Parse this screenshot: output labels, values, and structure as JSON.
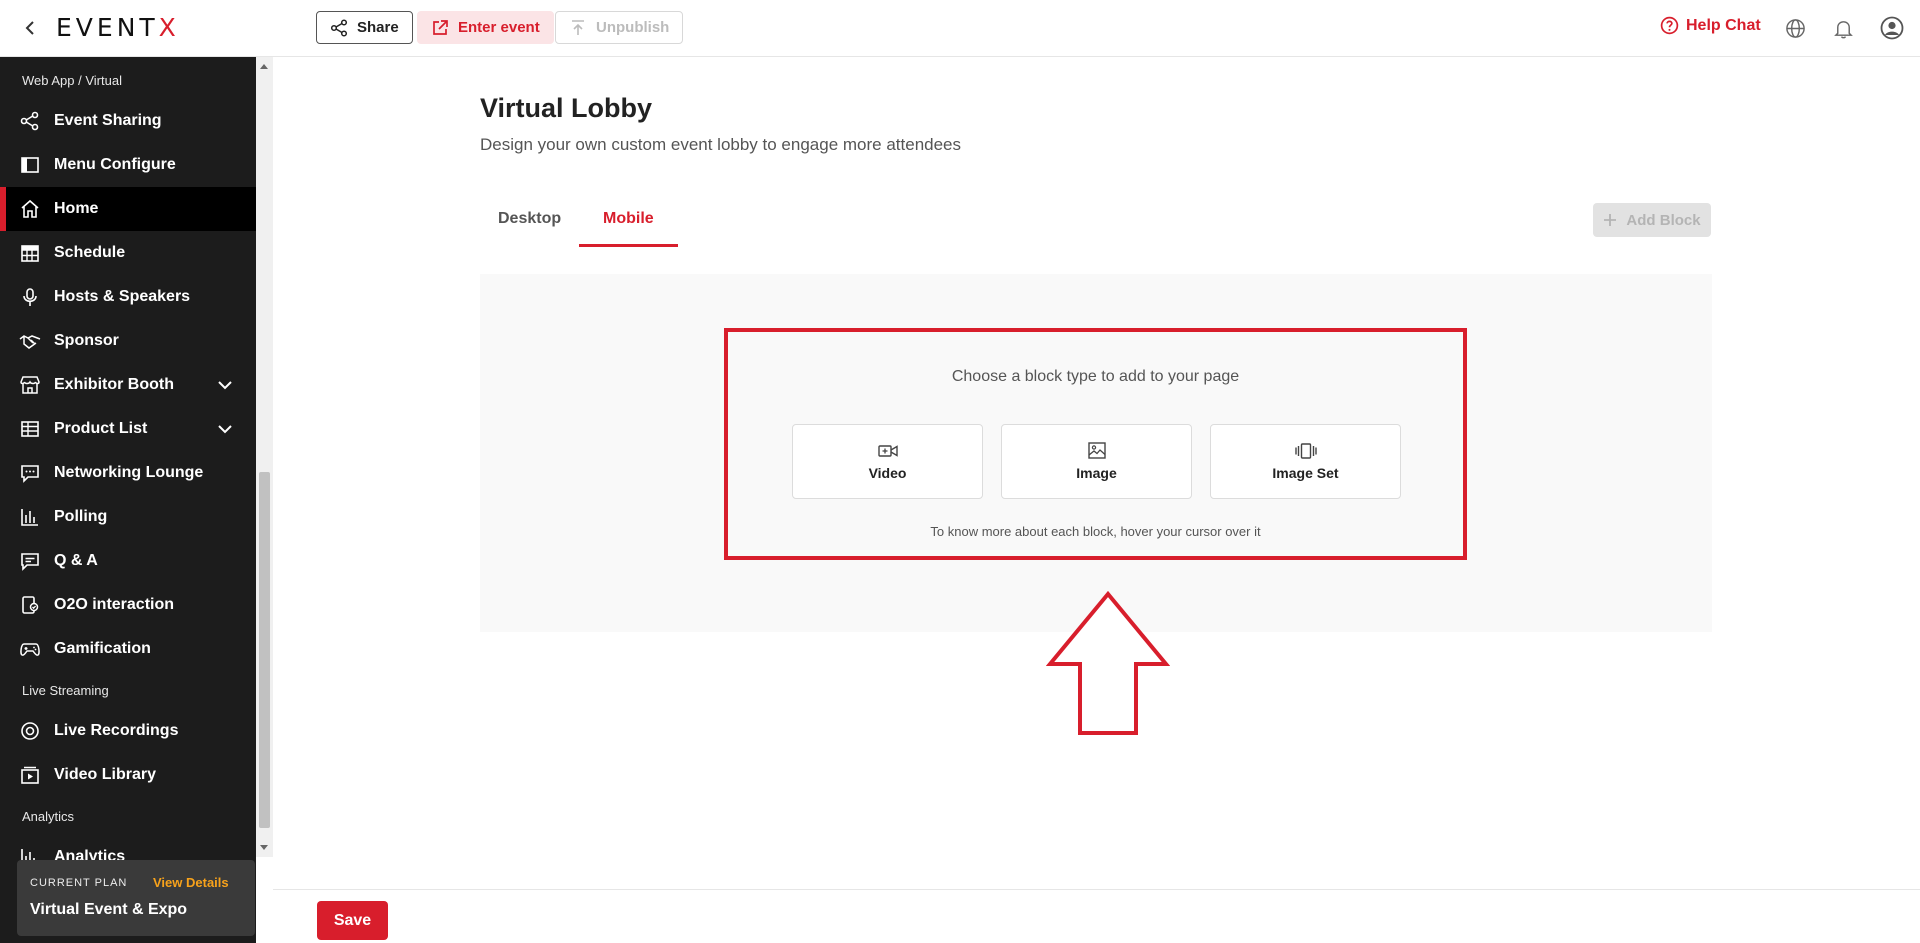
{
  "header": {
    "logo_main": "EVENT",
    "logo_accent": "X",
    "share_label": "Share",
    "enter_event_label": "Enter event",
    "unpublish_label": "Unpublish",
    "help_chat_label": "Help Chat"
  },
  "sidebar": {
    "section_web_app": "Web App / Virtual",
    "section_live_streaming": "Live Streaming",
    "section_analytics": "Analytics",
    "items": [
      {
        "label": "Event Sharing",
        "icon": "share-icon"
      },
      {
        "label": "Menu Configure",
        "icon": "panel-icon"
      },
      {
        "label": "Home",
        "icon": "home-icon",
        "active": true
      },
      {
        "label": "Schedule",
        "icon": "calendar-icon"
      },
      {
        "label": "Hosts & Speakers",
        "icon": "microphone-icon"
      },
      {
        "label": "Sponsor",
        "icon": "handshake-icon"
      },
      {
        "label": "Exhibitor Booth",
        "icon": "store-icon",
        "expandable": true
      },
      {
        "label": "Product List",
        "icon": "list-icon",
        "expandable": true
      },
      {
        "label": "Networking Lounge",
        "icon": "chat-icon"
      },
      {
        "label": "Polling",
        "icon": "bar-chart-icon"
      },
      {
        "label": "Q & A",
        "icon": "message-icon"
      },
      {
        "label": "O2O interaction",
        "icon": "interaction-icon"
      },
      {
        "label": "Gamification",
        "icon": "gamepad-icon"
      },
      {
        "label": "Live Recordings",
        "icon": "record-icon"
      },
      {
        "label": "Video Library",
        "icon": "video-library-icon"
      },
      {
        "label": "Analytics",
        "icon": "analytics-icon"
      }
    ],
    "plan": {
      "label": "CURRENT PLAN",
      "view_details": "View Details",
      "name": "Virtual Event & Expo"
    }
  },
  "main": {
    "title": "Virtual Lobby",
    "subtitle": "Design your own custom event lobby to engage more attendees",
    "tabs": [
      {
        "label": "Desktop",
        "active": false
      },
      {
        "label": "Mobile",
        "active": true
      }
    ],
    "add_block_label": "Add Block",
    "choose_text": "Choose a block type to add to your page",
    "blocks": [
      {
        "label": "Video",
        "icon": "video-add-icon"
      },
      {
        "label": "Image",
        "icon": "image-icon"
      },
      {
        "label": "Image Set",
        "icon": "image-set-icon"
      }
    ],
    "hint_text": "To know more about each block, hover your cursor over it"
  },
  "footer": {
    "save_label": "Save"
  },
  "colors": {
    "accent": "#d81e2c",
    "sidebar_bg": "#1c1c1c",
    "plan_link": "#f7a21b"
  }
}
